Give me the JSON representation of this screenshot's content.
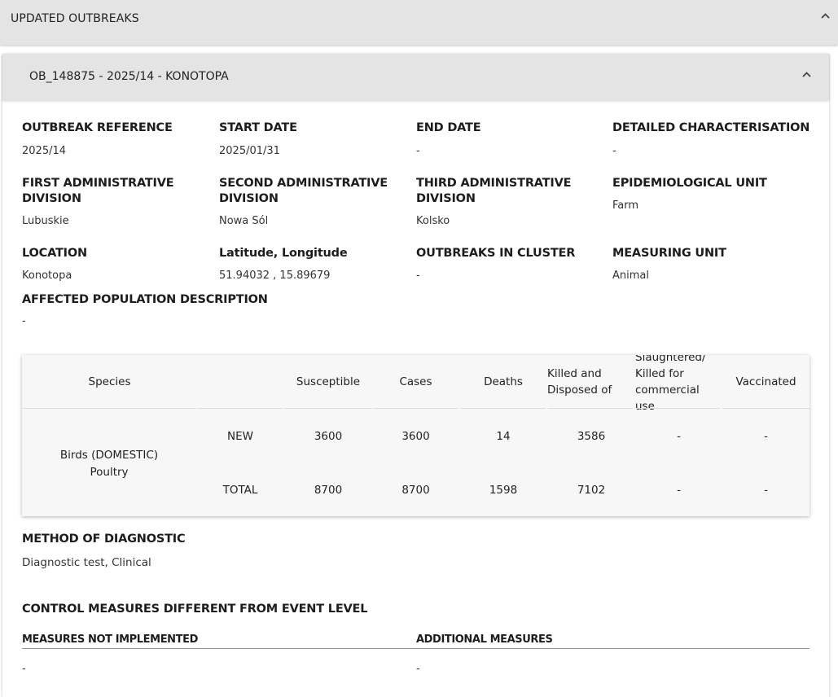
{
  "top_panel": {
    "title": "UPDATED OUTBREAKS"
  },
  "outbreak": {
    "title": "OB_148875 - 2025/14 - KONOTOPA",
    "fields": {
      "outbreak_reference": {
        "label": "OUTBREAK REFERENCE",
        "value": "2025/14"
      },
      "start_date": {
        "label": "START DATE",
        "value": "2025/01/31"
      },
      "end_date": {
        "label": "END DATE",
        "value": "-"
      },
      "detailed_characterisation": {
        "label": "DETAILED CHARACTERISATION",
        "value": "-"
      },
      "first_admin": {
        "label_line1": "FIRST ADMINISTRATIVE",
        "label_line2": "DIVISION",
        "value": "Lubuskie"
      },
      "second_admin": {
        "label_line1": "SECOND ADMINISTRATIVE",
        "label_line2": "DIVISION",
        "value": "Nowa Sól"
      },
      "third_admin": {
        "label_line1": "THIRD ADMINISTRATIVE",
        "label_line2": "DIVISION",
        "value": "Kolsko"
      },
      "epidemiological_unit": {
        "label": "EPIDEMIOLOGICAL UNIT",
        "value": "Farm"
      },
      "location": {
        "label": "LOCATION",
        "value": "Konotopa"
      },
      "lat_long": {
        "label": "Latitude, Longitude",
        "value": "51.94032 , 15.89679"
      },
      "outbreaks_in_cluster": {
        "label": "OUTBREAKS IN CLUSTER",
        "value": "-"
      },
      "measuring_unit": {
        "label": "MEASURING UNIT",
        "value": "Animal"
      },
      "affected_population": {
        "label": "AFFECTED POPULATION DESCRIPTION",
        "value": "-"
      }
    },
    "table": {
      "headers": {
        "species": "Species",
        "susceptible": "Susceptible",
        "cases": "Cases",
        "deaths": "Deaths",
        "killed_line1": "Killed and",
        "killed_line2": "Disposed of",
        "slaughtered_line1": "Slaughtered/",
        "slaughtered_line2": "Killed for",
        "slaughtered_line3": "commercial",
        "slaughtered_line4": "use",
        "vaccinated": "Vaccinated"
      },
      "species_line1": "Birds (DOMESTIC)",
      "species_line2": "Poultry",
      "rows": [
        {
          "type": "NEW",
          "susceptible": "3600",
          "cases": "3600",
          "deaths": "14",
          "killed": "3586",
          "slaughtered": "-",
          "vaccinated": "-"
        },
        {
          "type": "TOTAL",
          "susceptible": "8700",
          "cases": "8700",
          "deaths": "1598",
          "killed": "7102",
          "slaughtered": "-",
          "vaccinated": "-"
        }
      ]
    },
    "method_of_diagnostic": {
      "label": "METHOD OF DIAGNOSTIC",
      "value": "Diagnostic test, Clinical"
    },
    "control_measures": {
      "title": "CONTROL MEASURES DIFFERENT FROM EVENT LEVEL",
      "not_implemented_label": "MEASURES NOT IMPLEMENTED",
      "not_implemented_value": "-",
      "additional_label": "ADDITIONAL MEASURES",
      "additional_value": "-"
    }
  },
  "icons": {
    "collapse": "chevron-up-icon"
  }
}
